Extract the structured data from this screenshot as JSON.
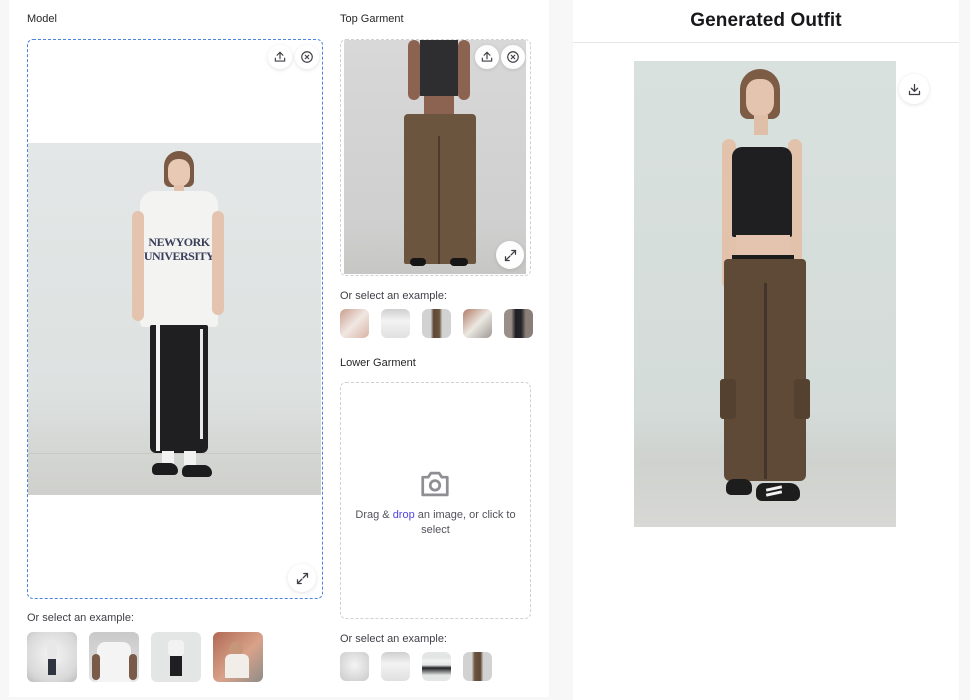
{
  "model": {
    "label": "Model",
    "examples_label": "Or select an example:",
    "examples": [
      {
        "name": "man in white hoodie and dark jeans, back view"
      },
      {
        "name": "man in white t-shirt with chain necklace"
      },
      {
        "name": "woman in NYU tee and black skirt"
      },
      {
        "name": "man in white shirt on street"
      }
    ],
    "image_alt": "Woman wearing New York University t-shirt and black track skirt",
    "tshirt_text_line1": "NEWYORK",
    "tshirt_text_line2": "UNIVERSITY",
    "upload_icon": "upload-icon",
    "clear_icon": "close-circle-icon",
    "expand_icon": "expand-icon"
  },
  "top_garment": {
    "label": "Top Garment",
    "examples_label": "Or select an example:",
    "image_alt": "Woman in black tank top and brown cargo pants",
    "examples": [
      {
        "name": "white lace dress"
      },
      {
        "name": "white t-shirt"
      },
      {
        "name": "brown cargo pants outfit"
      },
      {
        "name": "white shirt on street"
      },
      {
        "name": "black suit"
      }
    ]
  },
  "lower_garment": {
    "label": "Lower Garment",
    "placeholder_prefix": "Drag & ",
    "placeholder_accent": "drop",
    "placeholder_suffix": " an image, or click to select",
    "camera_icon": "camera-icon",
    "examples_label": "Or select an example:",
    "examples": [
      {
        "name": "man in white hoodie"
      },
      {
        "name": "man in white t-shirt"
      },
      {
        "name": "woman in NYU tee"
      },
      {
        "name": "brown cargo pants"
      }
    ]
  },
  "output": {
    "title": "Generated Outfit",
    "image_alt": "Generated outfit: woman in black tank top and brown cargo pants",
    "download_icon": "download-icon"
  },
  "colors": {
    "accent_blue": "#4b82e0",
    "link_indigo": "#4f46e5"
  }
}
